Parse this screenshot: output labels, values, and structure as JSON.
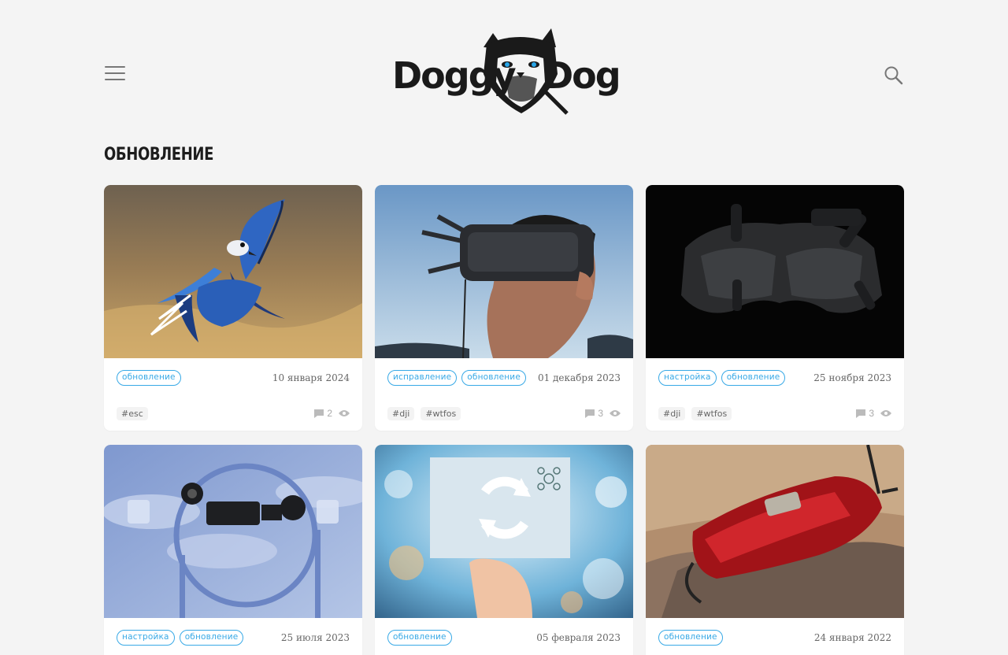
{
  "site": {
    "logo_text": "DoggyDog"
  },
  "section": {
    "title": "Обновление"
  },
  "cards": [
    {
      "cats": [
        "обновление"
      ],
      "date": "10 января 2024",
      "tags": [
        "#esc"
      ],
      "comments": "2"
    },
    {
      "cats": [
        "исправление",
        "обновление"
      ],
      "date": "01 декабря 2023",
      "tags": [
        "#dji",
        "#wtfos"
      ],
      "comments": "3"
    },
    {
      "cats": [
        "настройка",
        "обновление"
      ],
      "date": "25 ноября 2023",
      "tags": [
        "#dji",
        "#wtfos"
      ],
      "comments": "3"
    },
    {
      "cats": [
        "настройка",
        "обновление"
      ],
      "date": "25 июля 2023"
    },
    {
      "cats": [
        "обновление"
      ],
      "date": "05 февраля 2023"
    },
    {
      "cats": [
        "обновление"
      ],
      "date": "24 января 2022"
    }
  ],
  "colors": {
    "accent": "#38a9e6",
    "background": "#f4f4f4"
  }
}
